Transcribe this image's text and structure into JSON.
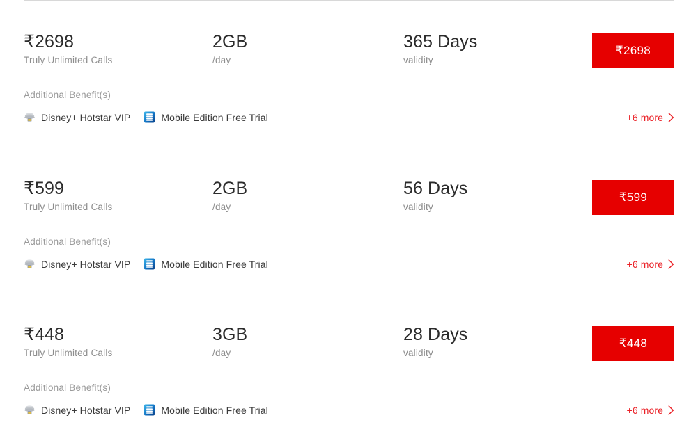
{
  "page": {
    "currency_symbol": "₹",
    "accent_color": "#e60000",
    "link_color": "#ea2127",
    "muted_color": "#8d8d8d"
  },
  "labels": {
    "additional_benefits": "Additional Benefit(s)",
    "calls_sub": "Truly Unlimited Calls",
    "data_sub": "/day",
    "validity_sub": "validity",
    "more_label": "+6 more"
  },
  "benefit_icons": {
    "disney": "disney-hotstar-icon",
    "mobile_edition": "mobile-edition-icon"
  },
  "plans": [
    {
      "price": "₹2698",
      "price_sub": "Truly Unlimited Calls",
      "data": "2GB",
      "data_sub": "/day",
      "validity": "365 Days",
      "validity_sub": "validity",
      "benefits_label": "Additional Benefit(s)",
      "benefits": [
        {
          "icon": "disney-hotstar-icon",
          "text": "Disney+ Hotstar VIP"
        },
        {
          "icon": "mobile-edition-icon",
          "text": "Mobile Edition Free Trial"
        }
      ],
      "cta_label": "₹2698",
      "more_label": "+6 more"
    },
    {
      "price": "₹599",
      "price_sub": "Truly Unlimited Calls",
      "data": "2GB",
      "data_sub": "/day",
      "validity": "56 Days",
      "validity_sub": "validity",
      "benefits_label": "Additional Benefit(s)",
      "benefits": [
        {
          "icon": "disney-hotstar-icon",
          "text": "Disney+ Hotstar VIP"
        },
        {
          "icon": "mobile-edition-icon",
          "text": "Mobile Edition Free Trial"
        }
      ],
      "cta_label": "₹599",
      "more_label": "+6 more"
    },
    {
      "price": "₹448",
      "price_sub": "Truly Unlimited Calls",
      "data": "3GB",
      "data_sub": "/day",
      "validity": "28 Days",
      "validity_sub": "validity",
      "benefits_label": "Additional Benefit(s)",
      "benefits": [
        {
          "icon": "disney-hotstar-icon",
          "text": "Disney+ Hotstar VIP"
        },
        {
          "icon": "mobile-edition-icon",
          "text": "Mobile Edition Free Trial"
        }
      ],
      "cta_label": "₹448",
      "more_label": "+6 more"
    }
  ]
}
